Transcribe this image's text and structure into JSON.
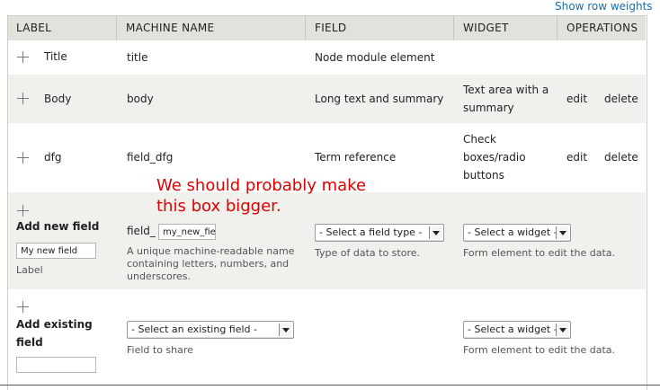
{
  "toolbar": {
    "show_row_weights": "Show row weights"
  },
  "table": {
    "headers": {
      "label": "LABEL",
      "machine_name": "MACHINE NAME",
      "field": "FIELD",
      "widget": "WIDGET",
      "operations": "OPERATIONS"
    },
    "rows": [
      {
        "label": "Title",
        "machine_name": "title",
        "field": "Node module element"
      },
      {
        "label": "Body",
        "machine_name": "body",
        "field": "Long text and summary",
        "widget_line1": "Text area with a",
        "widget_line2": "summary",
        "edit": "edit",
        "delete": "delete"
      },
      {
        "label": "dfg",
        "machine_name": "field_dfg",
        "field": "Term reference",
        "widget_line1": "Check",
        "widget_line2": "boxes/radio",
        "widget_line3": "buttons",
        "edit": "edit",
        "delete": "delete"
      }
    ]
  },
  "add_new_field": {
    "title": "Add new field",
    "label_value": "My new field",
    "label_caption": "Label",
    "machine_prefix": "field_",
    "machine_value": "my_new_fie",
    "machine_desc_line1": "A unique machine-readable name",
    "machine_desc_line2": "containing letters, numbers, and",
    "machine_desc_line3": "underscores.",
    "field_type_select": "- Select a field type -",
    "field_type_desc": "Type of data to store.",
    "widget_select": "- Select a widget -",
    "widget_desc": "Form element to edit the data."
  },
  "add_existing_field": {
    "title_line1": "Add existing",
    "title_line2": "field",
    "existing_select": "- Select an existing field -",
    "existing_desc": "Field to share",
    "widget_select": "- Select a widget -",
    "widget_desc": "Form element to edit the data."
  },
  "annotation": {
    "line1": "We should probably make",
    "line2": "this box bigger."
  },
  "colors": {
    "link": "#1a6ea8",
    "annotation": "#e00000",
    "header_bg": "#e1e2dc",
    "row_alt_bg": "#f0f1ec"
  }
}
